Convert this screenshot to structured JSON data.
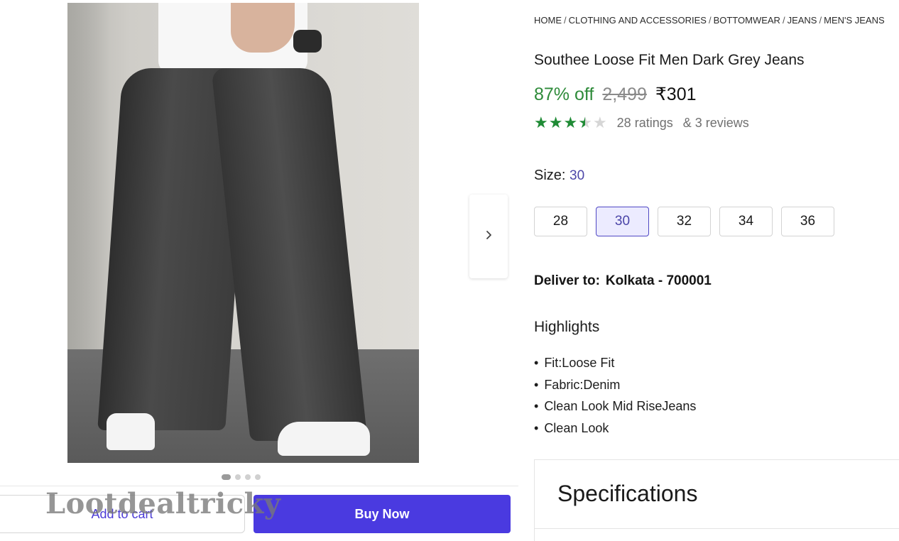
{
  "breadcrumb": [
    "HOME",
    "CLOTHING AND ACCESSORIES",
    "BOTTOMWEAR",
    "JEANS",
    "MEN'S JEANS"
  ],
  "product": {
    "title": "Southee Loose Fit Men Dark Grey Jeans",
    "discount": "87% off",
    "mrp": "2,499",
    "price": "₹301"
  },
  "rating": {
    "value": 3.5,
    "ratings_text": "28 ratings",
    "reviews_text": "& 3 reviews"
  },
  "size": {
    "label": "Size:",
    "selected": "30",
    "options": [
      "28",
      "30",
      "32",
      "34",
      "36"
    ]
  },
  "delivery": {
    "label": "Deliver to:",
    "location": "Kolkata - 700001"
  },
  "highlights": {
    "title": "Highlights",
    "items": [
      "Fit:Loose Fit",
      "Fabric:Denim",
      "Clean Look Mid RiseJeans",
      "Clean Look"
    ]
  },
  "specifications": {
    "title": "Specifications"
  },
  "actions": {
    "add_to_cart": "Add to cart",
    "buy_now": "Buy Now"
  },
  "carousel": {
    "count": 4,
    "active": 0
  },
  "watermark": "Lootdealtricky",
  "icons": {
    "next": "chevron-right-icon",
    "star": "star-icon"
  },
  "colors": {
    "discount": "#2e8b3a",
    "star": "#1f8b35",
    "accent": "#4a3ae0",
    "selected_size_bg": "#ecebff"
  }
}
